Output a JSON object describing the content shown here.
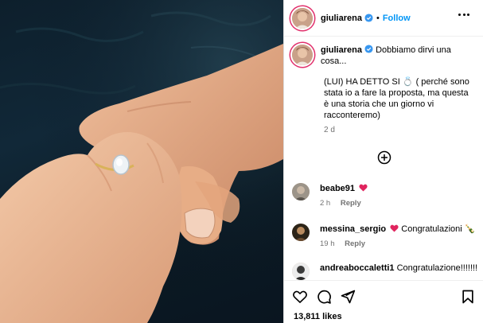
{
  "post": {
    "username": "giuliarena",
    "follow_label": "Follow",
    "separator": "•",
    "caption_line1": "Dobbiamo dirvi una cosa...",
    "caption_body": "(LUI) HA DETTO SI 💍 ( perché sono stata io a fare la proposta, ma questa è una storia che un giorno vi racconteremo)",
    "caption_time": "2 d",
    "likes": "13,811 likes"
  },
  "comments": [
    {
      "username": "beabe91",
      "text": "",
      "time": "2 h",
      "reply_label": "Reply"
    },
    {
      "username": "messina_sergio",
      "text": "Congratulazioni 🍾",
      "time": "19 h",
      "reply_label": "Reply"
    },
    {
      "username": "andreaboccaletti1",
      "text": "Congratulazione!!!!!!!",
      "time": "",
      "reply_label": ""
    }
  ],
  "colors": {
    "accent": "#0095f6",
    "heart": "#ed4956",
    "verified": "#3897f0"
  },
  "icons": [
    "verified-badge-icon",
    "more-options-icon",
    "load-more-plus-icon",
    "heart-icon",
    "comment-icon",
    "share-icon",
    "bookmark-icon"
  ]
}
